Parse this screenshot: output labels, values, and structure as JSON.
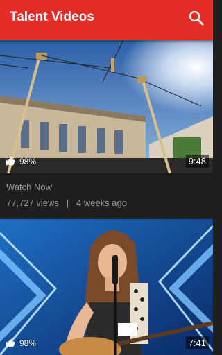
{
  "app": {
    "title": "Talent Videos"
  },
  "videos": [
    {
      "rating": "98%",
      "duration": "9:48",
      "title": "Watch Now",
      "views": "77,727 views",
      "separator": "|",
      "age": "4 weeks ago"
    },
    {
      "rating": "98%",
      "duration": "7:41"
    }
  ],
  "colors": {
    "appbar": "#e52d27",
    "background": "#1e1e1e",
    "meta_text": "#9a9a9a"
  },
  "icons": {
    "search": "search-icon",
    "like": "thumbs-up-icon"
  }
}
